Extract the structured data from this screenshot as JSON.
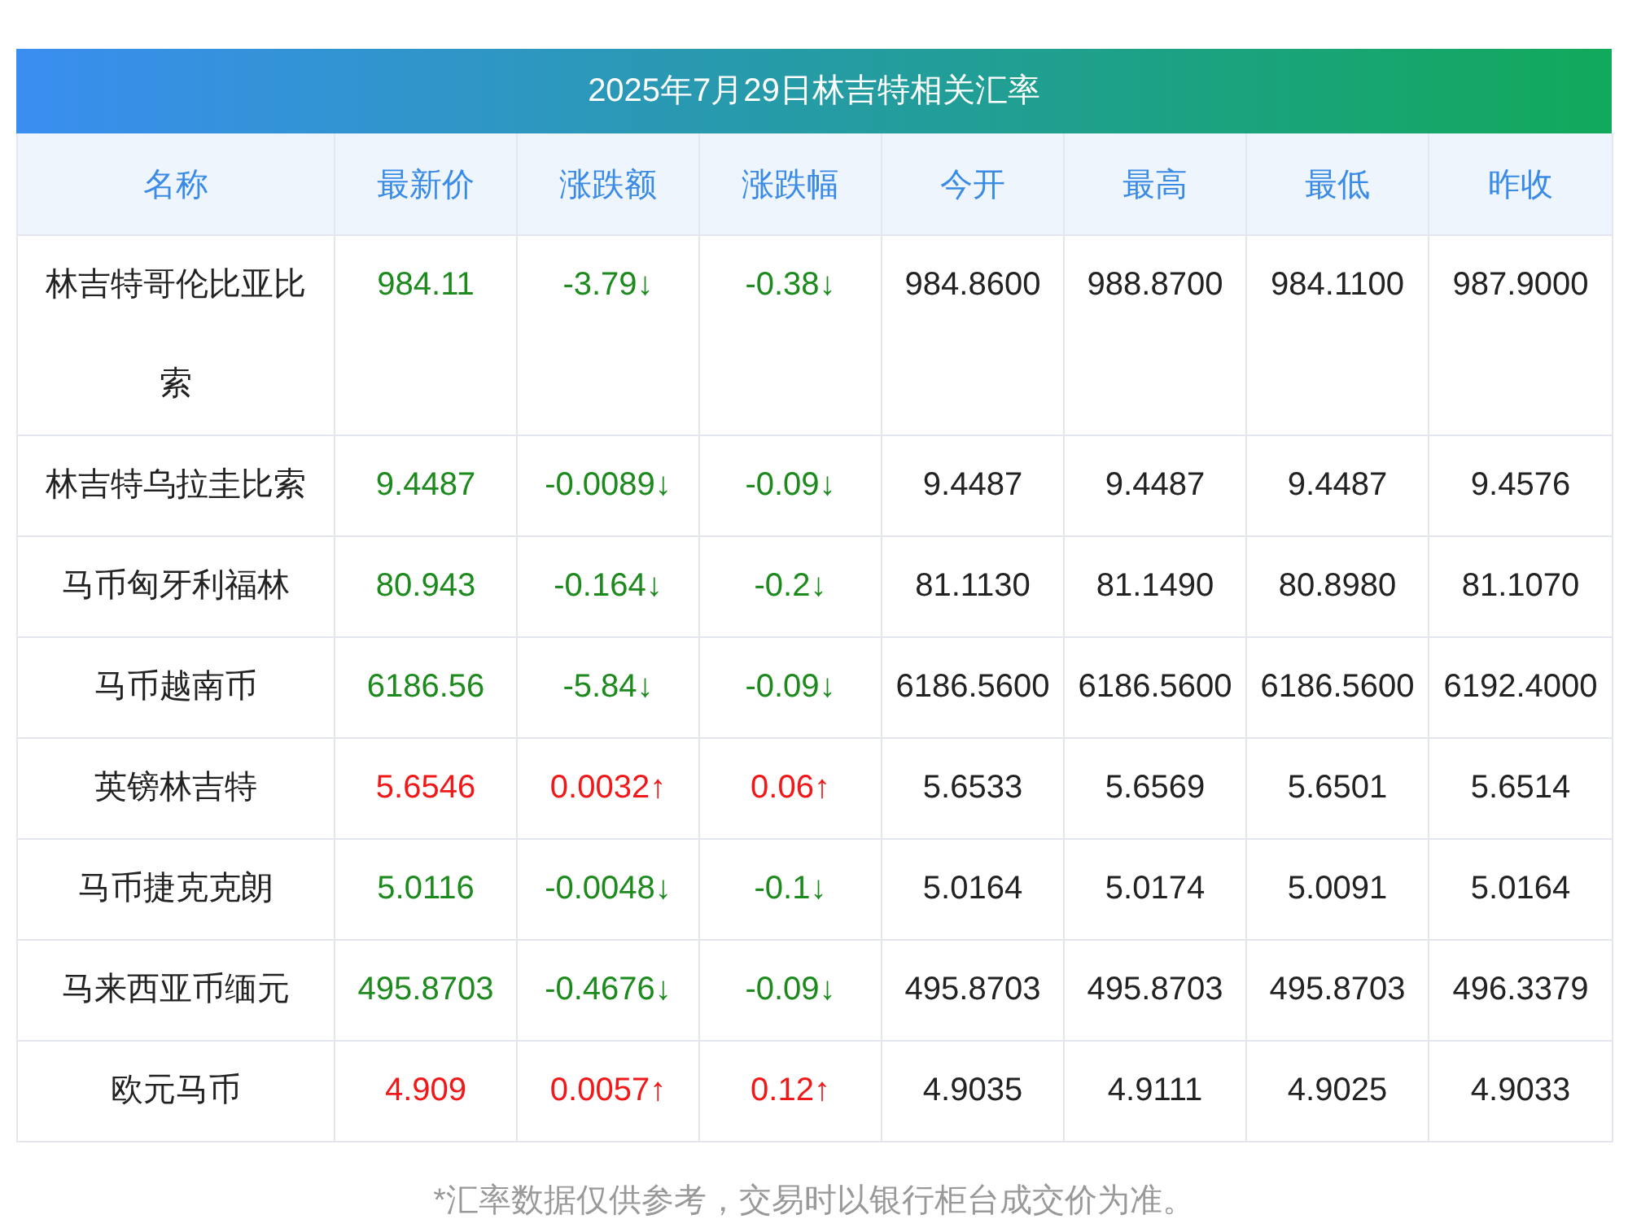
{
  "title": "2025年7月29日林吉特相关汇率",
  "columns": [
    "名称",
    "最新价",
    "涨跌额",
    "涨跌幅",
    "今开",
    "最高",
    "最低",
    "昨收"
  ],
  "rows": [
    {
      "color": "#1c8a1c",
      "cells": [
        "林吉特哥伦比亚比索",
        "984.11",
        "-3.79↓",
        "-0.38↓",
        "984.8600",
        "988.8700",
        "984.1100",
        "987.9000"
      ]
    },
    {
      "color": "#1c8a1c",
      "cells": [
        "林吉特乌拉圭比索",
        "9.4487",
        "-0.0089↓",
        "-0.09↓",
        "9.4487",
        "9.4487",
        "9.4487",
        "9.4576"
      ]
    },
    {
      "color": "#1c8a1c",
      "cells": [
        "马币匈牙利福林",
        "80.943",
        "-0.164↓",
        "-0.2↓",
        "81.1130",
        "81.1490",
        "80.8980",
        "81.1070"
      ]
    },
    {
      "color": "#1c8a1c",
      "cells": [
        "马币越南币",
        "6186.56",
        "-5.84↓",
        "-0.09↓",
        "6186.5600",
        "6186.5600",
        "6186.5600",
        "6192.4000"
      ]
    },
    {
      "color": "#f01818",
      "cells": [
        "英镑林吉特",
        "5.6546",
        "0.0032↑",
        "0.06↑",
        "5.6533",
        "5.6569",
        "5.6501",
        "5.6514"
      ]
    },
    {
      "color": "#1c8a1c",
      "cells": [
        "马币捷克克朗",
        "5.0116",
        "-0.0048↓",
        "-0.1↓",
        "5.0164",
        "5.0174",
        "5.0091",
        "5.0164"
      ]
    },
    {
      "color": "#1c8a1c",
      "cells": [
        "马来西亚币缅元",
        "495.8703",
        "-0.4676↓",
        "-0.09↓",
        "495.8703",
        "495.8703",
        "495.8703",
        "496.3379"
      ]
    },
    {
      "color": "#f01818",
      "cells": [
        "欧元马币",
        "4.909",
        "0.0057↑",
        "0.12↑",
        "4.9035",
        "4.9111",
        "4.9025",
        "4.9033"
      ]
    }
  ],
  "footnote": "*汇率数据仅供参考，交易时以银行柜台成交价为准。"
}
